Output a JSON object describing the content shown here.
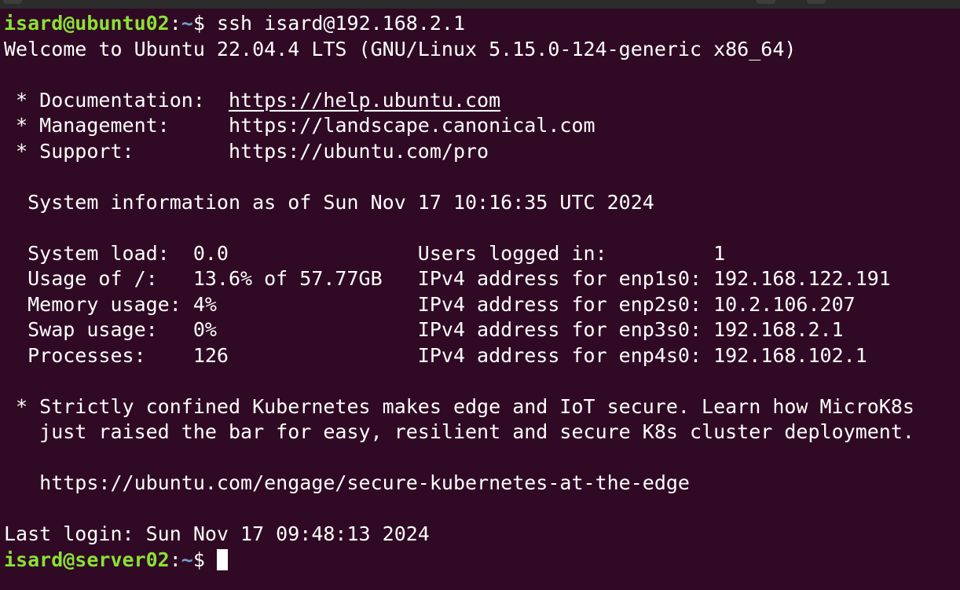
{
  "window": {
    "background": "#300a24",
    "prompt_user_color": "#8ae234",
    "prompt_path_color": "#729fcf"
  },
  "prompt1": {
    "userhost": "isard@ubuntu02",
    "colon": ":",
    "path": "~",
    "symbol": "$ ",
    "command": "ssh isard@192.168.2.1"
  },
  "welcome": "Welcome to Ubuntu 22.04.4 LTS (GNU/Linux 5.15.0-124-generic x86_64)",
  "links": [
    {
      "label": " * Documentation:  ",
      "url": "https://help.ubuntu.com"
    },
    {
      "label": " * Management:     ",
      "url": "https://landscape.canonical.com"
    },
    {
      "label": " * Support:        ",
      "url": "https://ubuntu.com/pro"
    }
  ],
  "sysinfo_header": "  System information as of Sun Nov 17 10:16:35 UTC 2024",
  "sysinfo_rows": [
    "  System load:  0.0                Users logged in:         1",
    "  Usage of /:   13.6% of 57.77GB   IPv4 address for enp1s0: 192.168.122.191",
    "  Memory usage: 4%                 IPv4 address for enp2s0: 10.2.106.207",
    "  Swap usage:   0%                 IPv4 address for enp3s0: 192.168.2.1",
    "  Processes:    126                IPv4 address for enp4s0: 192.168.102.1"
  ],
  "notice": [
    " * Strictly confined Kubernetes makes edge and IoT secure. Learn how MicroK8s",
    "   just raised the bar for easy, resilient and secure K8s cluster deployment."
  ],
  "notice_url": "   https://ubuntu.com/engage/secure-kubernetes-at-the-edge",
  "last_login": "Last login: Sun Nov 17 09:48:13 2024",
  "prompt2": {
    "userhost": "isard@server02",
    "colon": ":",
    "path": "~",
    "symbol": "$ "
  }
}
